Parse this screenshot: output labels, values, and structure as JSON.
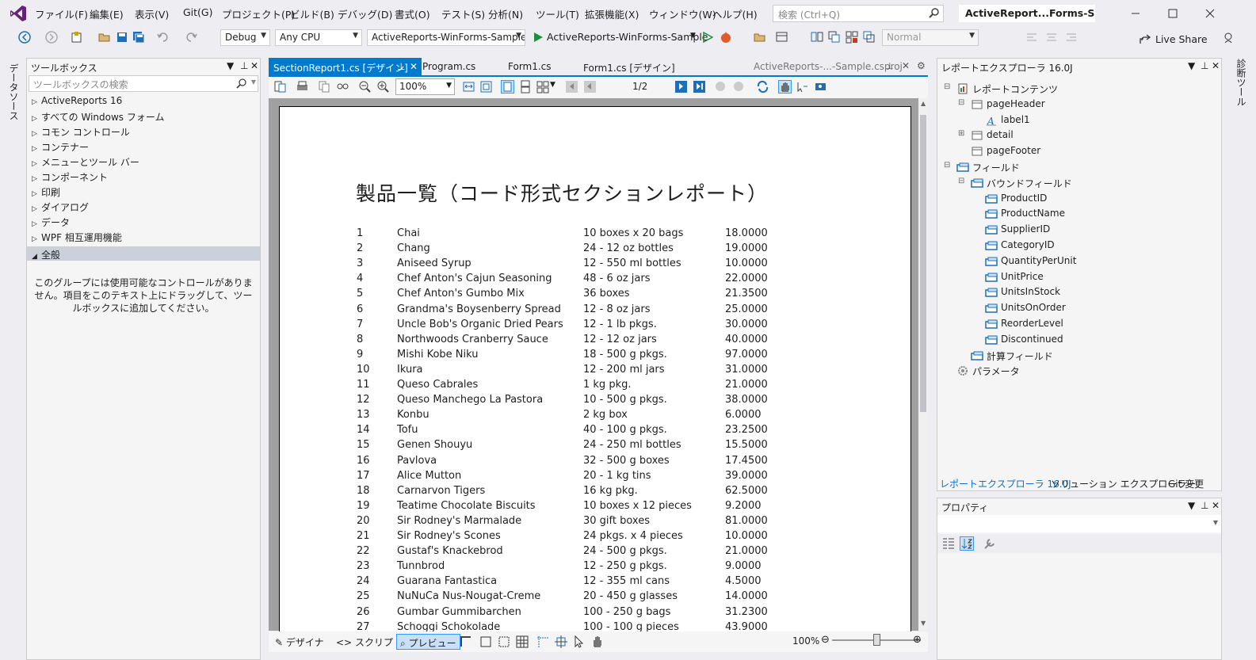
{
  "menubar": {
    "items": [
      "ファイル(F)",
      "編集(E)",
      "表示(V)",
      "Git(G)",
      "プロジェクト(P)",
      "ビルド(B)",
      "デバッグ(D)",
      "書式(O)",
      "テスト(S)",
      "分析(N)",
      "ツール(T)",
      "拡張機能(X)",
      "ウィンドウ(W)",
      "ヘルプ(H)"
    ],
    "search_placeholder": "検索 (Ctrl+Q)",
    "window_title": "ActiveReport...Forms-Sample"
  },
  "toolbar": {
    "config": "Debug",
    "platform": "Any CPU",
    "project": "ActiveReports-WinForms-Sample",
    "run_target": "ActiveReports-WinForms-Sample",
    "style_combo": "Normal",
    "live_share": "Live Share"
  },
  "side": {
    "left_label": "データソース",
    "right_label": "診断ツール"
  },
  "toolbox": {
    "title": "ツールボックス",
    "search_placeholder": "ツールボックスの検索",
    "groups": [
      "ActiveReports 16",
      "すべての Windows フォーム",
      "コモン コントロール",
      "コンテナー",
      "メニューとツール バー",
      "コンポーネント",
      "印刷",
      "ダイアログ",
      "データ",
      "WPF 相互運用機能"
    ],
    "selected_group": "全般",
    "empty_text": "このグループには使用可能なコントロールがありません。項目をこのテキスト上にドラッグして、ツールボックスに追加してください。"
  },
  "tabs": {
    "active": "SectionReport1.cs [デザイン]",
    "others": [
      "Program.cs",
      "Form1.cs",
      "Form1.cs [デザイン]"
    ],
    "right": "ActiveReports-...-Sample.csproj"
  },
  "viewer": {
    "zoom": "100%",
    "page": "1/2",
    "report_title": "製品一覧（コード形式セクションレポート）",
    "rows": [
      [
        "1",
        "Chai",
        "10 boxes x 20 bags",
        "18.0000"
      ],
      [
        "2",
        "Chang",
        "24 - 12 oz bottles",
        "19.0000"
      ],
      [
        "3",
        "Aniseed Syrup",
        "12 - 550 ml bottles",
        "10.0000"
      ],
      [
        "4",
        "Chef Anton's Cajun Seasoning",
        "48 - 6 oz jars",
        "22.0000"
      ],
      [
        "5",
        "Chef Anton's Gumbo Mix",
        "36 boxes",
        "21.3500"
      ],
      [
        "6",
        "Grandma's Boysenberry Spread",
        "12 - 8 oz jars",
        "25.0000"
      ],
      [
        "7",
        "Uncle Bob's Organic Dried Pears",
        "12 - 1 lb pkgs.",
        "30.0000"
      ],
      [
        "8",
        "Northwoods Cranberry Sauce",
        "12 - 12 oz jars",
        "40.0000"
      ],
      [
        "9",
        "Mishi Kobe Niku",
        "18 - 500 g pkgs.",
        "97.0000"
      ],
      [
        "10",
        "Ikura",
        "12 - 200 ml jars",
        "31.0000"
      ],
      [
        "11",
        "Queso Cabrales",
        "1 kg pkg.",
        "21.0000"
      ],
      [
        "12",
        "Queso Manchego La Pastora",
        "10 - 500 g pkgs.",
        "38.0000"
      ],
      [
        "13",
        "Konbu",
        "2 kg box",
        "6.0000"
      ],
      [
        "14",
        "Tofu",
        "40 - 100 g pkgs.",
        "23.2500"
      ],
      [
        "15",
        "Genen Shouyu",
        "24 - 250 ml bottles",
        "15.5000"
      ],
      [
        "16",
        "Pavlova",
        "32 - 500 g boxes",
        "17.4500"
      ],
      [
        "17",
        "Alice Mutton",
        "20 - 1 kg tins",
        "39.0000"
      ],
      [
        "18",
        "Carnarvon Tigers",
        "16 kg pkg.",
        "62.5000"
      ],
      [
        "19",
        "Teatime Chocolate Biscuits",
        "10 boxes x 12 pieces",
        "9.2000"
      ],
      [
        "20",
        "Sir Rodney's Marmalade",
        "30 gift boxes",
        "81.0000"
      ],
      [
        "21",
        "Sir Rodney's Scones",
        "24 pkgs. x 4 pieces",
        "10.0000"
      ],
      [
        "22",
        "Gustaf's Knackebrod",
        "24 - 500 g pkgs.",
        "21.0000"
      ],
      [
        "23",
        "Tunnbrod",
        "12 - 250 g pkgs.",
        "9.0000"
      ],
      [
        "24",
        "Guarana Fantastica",
        "12 - 355 ml cans",
        "4.5000"
      ],
      [
        "25",
        "NuNuCa Nus-Nougat-Creme",
        "20 - 450 g glasses",
        "14.0000"
      ],
      [
        "26",
        "Gumbar Gummibarchen",
        "100 - 250 g bags",
        "31.2300"
      ],
      [
        "27",
        "Schoggi Schokolade",
        "100 - 100 g pieces",
        "43.9000"
      ]
    ]
  },
  "bottom": {
    "designer": "デザイナ",
    "script": "スクリプト",
    "preview": "プレビュー",
    "zoom": "100%",
    "zoom_level": 0.5
  },
  "report_explorer": {
    "title": "レポートエクスプローラ 16.0J",
    "nodes": [
      {
        "label": "レポートコンテンツ",
        "indent": 0,
        "icon": "report"
      },
      {
        "label": "pageHeader",
        "indent": 1,
        "icon": "section"
      },
      {
        "label": "label1",
        "indent": 2,
        "icon": "label"
      },
      {
        "label": "detail",
        "indent": 1,
        "icon": "section"
      },
      {
        "label": "pageFooter",
        "indent": 1,
        "icon": "section"
      },
      {
        "label": "フィールド",
        "indent": 0,
        "icon": "field"
      },
      {
        "label": "バウンドフィールド",
        "indent": 1,
        "icon": "field"
      },
      {
        "label": "ProductID",
        "indent": 2,
        "icon": "field"
      },
      {
        "label": "ProductName",
        "indent": 2,
        "icon": "field"
      },
      {
        "label": "SupplierID",
        "indent": 2,
        "icon": "field"
      },
      {
        "label": "CategoryID",
        "indent": 2,
        "icon": "field"
      },
      {
        "label": "QuantityPerUnit",
        "indent": 2,
        "icon": "field"
      },
      {
        "label": "UnitPrice",
        "indent": 2,
        "icon": "field"
      },
      {
        "label": "UnitsInStock",
        "indent": 2,
        "icon": "field"
      },
      {
        "label": "UnitsOnOrder",
        "indent": 2,
        "icon": "field"
      },
      {
        "label": "ReorderLevel",
        "indent": 2,
        "icon": "field"
      },
      {
        "label": "Discontinued",
        "indent": 2,
        "icon": "field"
      },
      {
        "label": "計算フィールド",
        "indent": 1,
        "icon": "field"
      },
      {
        "label": "パラメータ",
        "indent": 0,
        "icon": "gear"
      }
    ],
    "tabs": [
      "レポートエクスプローラ 16.0J",
      "ソリューション エクスプローラー",
      "Git 変更"
    ]
  },
  "properties": {
    "title": "プロパティ"
  },
  "colors": {
    "accent": "#007acc",
    "vs_purple": "#68217a",
    "run_green": "#1e8e3e"
  }
}
